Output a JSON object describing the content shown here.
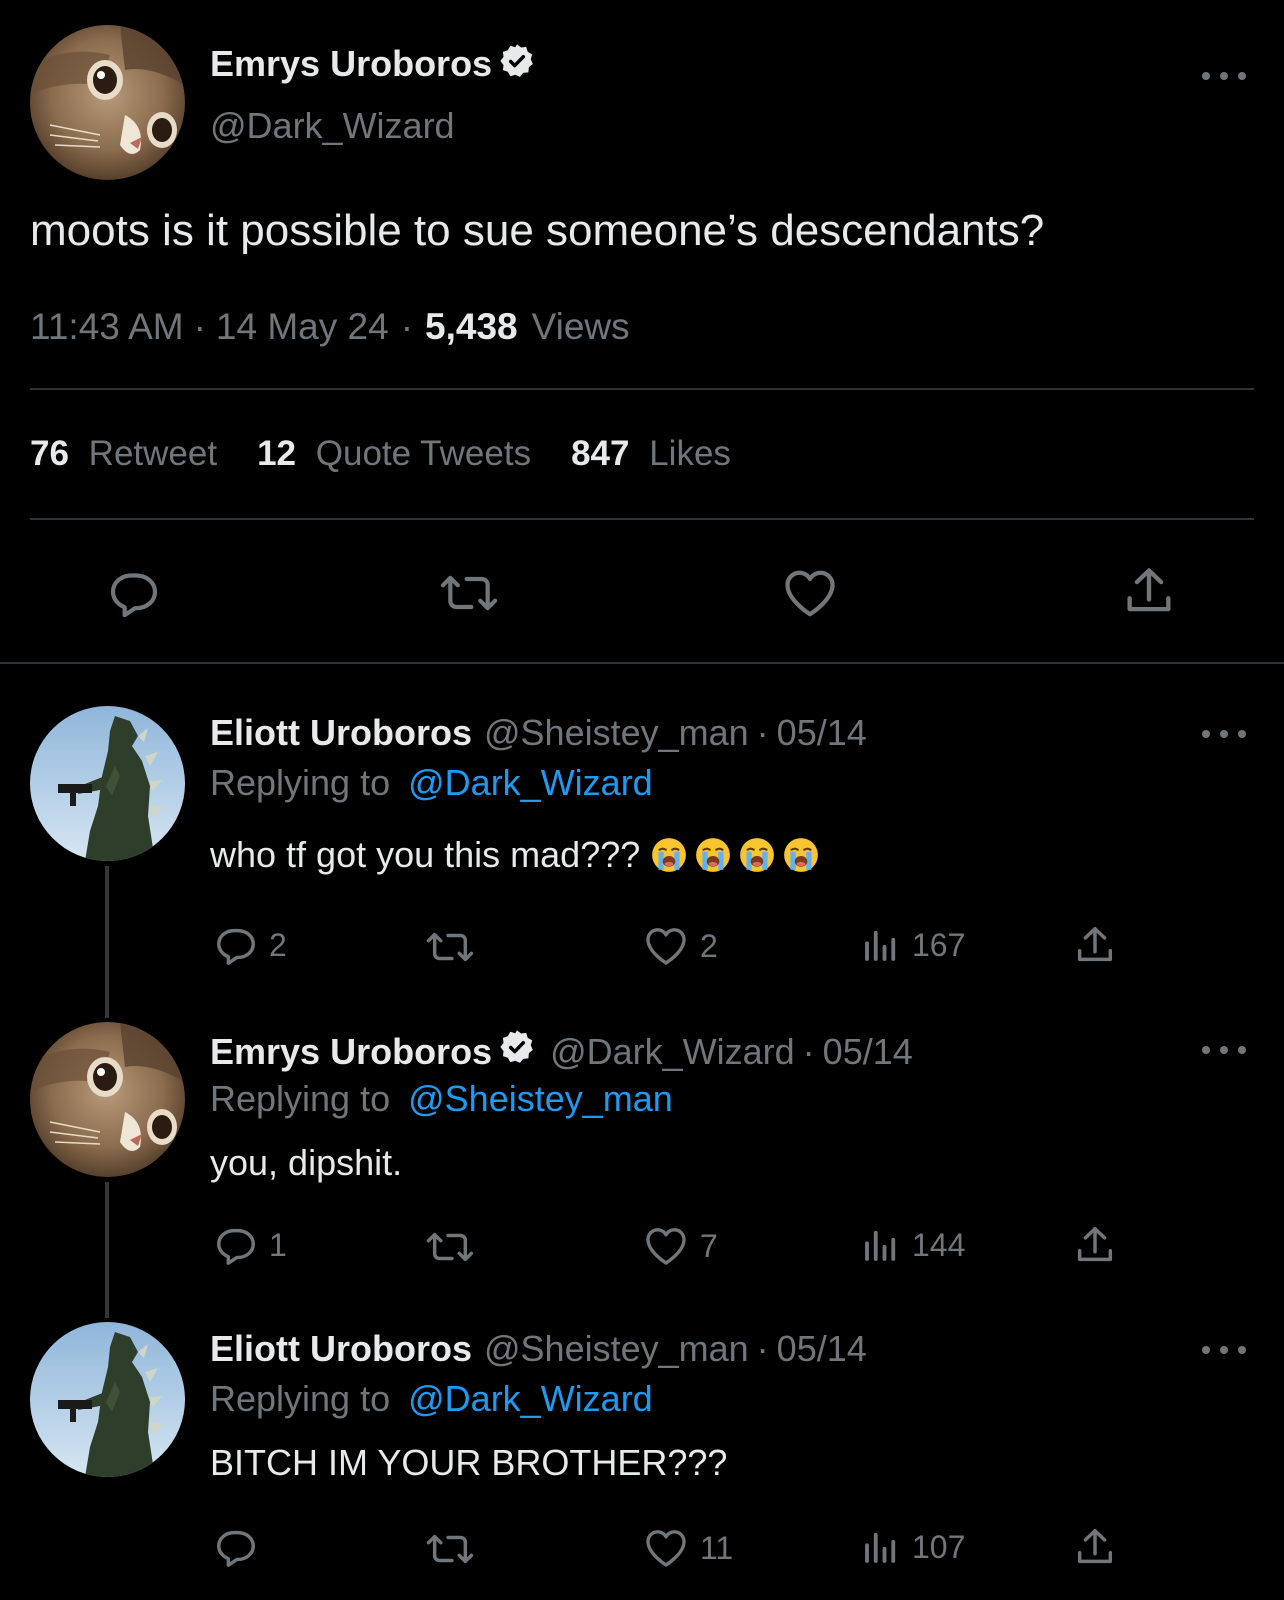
{
  "main_tweet": {
    "author_name": "Emrys Uroboros",
    "handle": "@Dark_Wizard",
    "text": "moots is it possible to sue someone’s descendants?",
    "time": "11:43 AM",
    "date": "14 May 24",
    "views_count": "5,438",
    "views_label": "Views",
    "retweets_count": "76",
    "retweets_label": "Retweet",
    "quotes_count": "12",
    "quotes_label": "Quote Tweets",
    "likes_count": "847",
    "likes_label": "Likes"
  },
  "replies": [
    {
      "author_name": "Eliott Uroboros",
      "handle": "@Sheistey_man",
      "date": "05/14",
      "replying_label": "Replying to",
      "replying_to": "@Dark_Wizard",
      "text": "who tf got you this mad???",
      "emoji_count": 4,
      "replies": "2",
      "retweets": "",
      "likes": "2",
      "views": "167"
    },
    {
      "author_name": "Emrys Uroboros",
      "handle": "@Dark_Wizard",
      "date": "05/14",
      "replying_label": "Replying to",
      "replying_to": "@Sheistey_man",
      "text": "you, dipshit.",
      "replies": "1",
      "retweets": "",
      "likes": "7",
      "views": "144"
    },
    {
      "author_name": "Eliott Uroboros",
      "handle": "@Sheistey_man",
      "date": "05/14",
      "replying_label": "Replying to",
      "replying_to": "@Dark_Wizard",
      "text": "BITCH IM YOUR BROTHER???",
      "replies": "",
      "retweets": "",
      "likes": "11",
      "views": "107"
    }
  ],
  "colors": {
    "background": "#000000",
    "text": "#e7e9ea",
    "muted": "#71767b",
    "link": "#1d9bf0",
    "divider": "#2f3336"
  }
}
